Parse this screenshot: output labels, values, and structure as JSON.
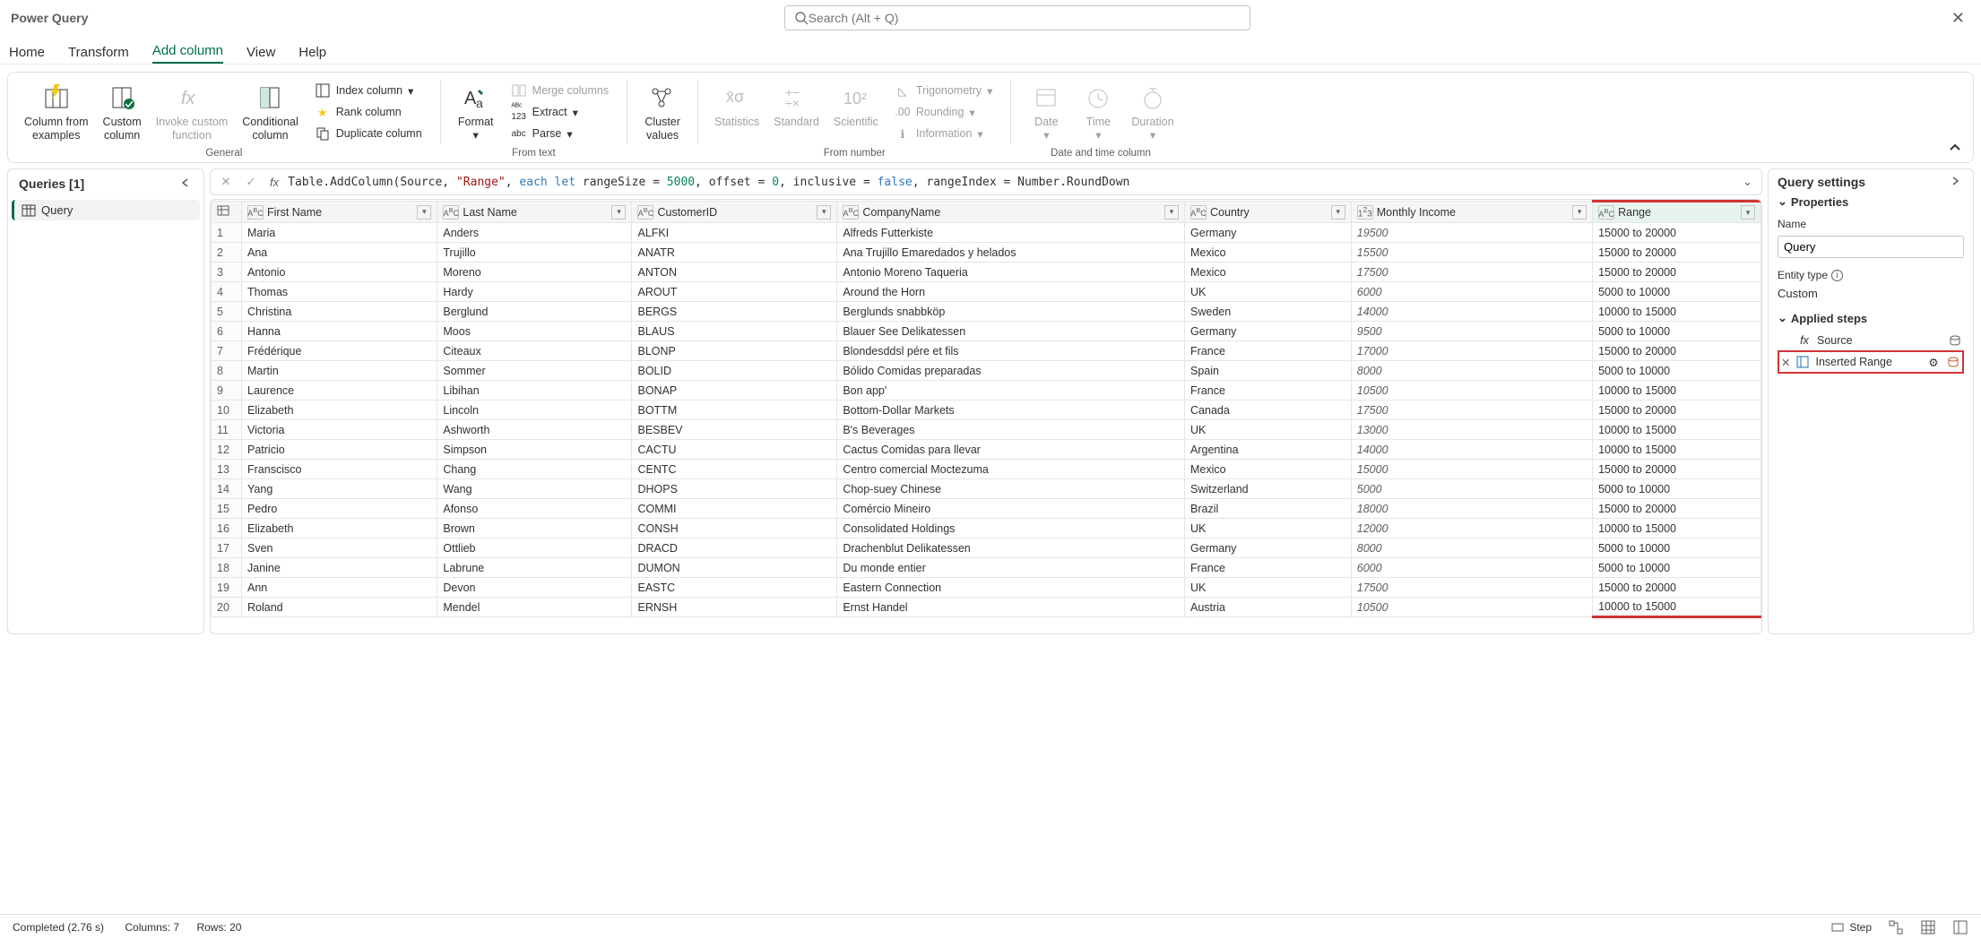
{
  "app_title": "Power Query",
  "search_placeholder": "Search (Alt + Q)",
  "tabs": {
    "home": "Home",
    "transform": "Transform",
    "add_column": "Add column",
    "view": "View",
    "help": "Help"
  },
  "ribbon": {
    "col_from_examples": "Column from\nexamples",
    "custom_column": "Custom\ncolumn",
    "invoke_custom_fn": "Invoke custom\nfunction",
    "conditional_col": "Conditional\ncolumn",
    "index_column": "Index column",
    "rank_column": "Rank column",
    "duplicate_column": "Duplicate column",
    "group_general": "General",
    "format": "Format",
    "merge_columns": "Merge columns",
    "extract": "Extract",
    "parse": "Parse",
    "group_text": "From text",
    "cluster_values": "Cluster\nvalues",
    "statistics": "Statistics",
    "standard": "Standard",
    "scientific": "Scientific",
    "trigonometry": "Trigonometry",
    "rounding": "Rounding",
    "information": "Information",
    "group_number": "From number",
    "date": "Date",
    "time": "Time",
    "duration": "Duration",
    "group_datetime": "Date and time column"
  },
  "queries_pane": {
    "title": "Queries [1]",
    "items": [
      {
        "label": "Query"
      }
    ]
  },
  "formula": {
    "prefix": "Table.AddColumn(Source, ",
    "str_range": "\"Range\"",
    "mid1": ", ",
    "kw_each_let": "each let",
    "mid2": " rangeSize = ",
    "num5000": "5000",
    "mid3": ", offset = ",
    "num0": "0",
    "mid4": ", inclusive = ",
    "bool_false": "false",
    "mid5": ", rangeIndex = Number.RoundDown"
  },
  "columns": [
    {
      "key": "first_name",
      "label": "First Name",
      "type": "text"
    },
    {
      "key": "last_name",
      "label": "Last Name",
      "type": "text"
    },
    {
      "key": "customer_id",
      "label": "CustomerID",
      "type": "text"
    },
    {
      "key": "company_name",
      "label": "CompanyName",
      "type": "text"
    },
    {
      "key": "country",
      "label": "Country",
      "type": "text"
    },
    {
      "key": "monthly_income",
      "label": "Monthly Income",
      "type": "number"
    },
    {
      "key": "range",
      "label": "Range",
      "type": "text"
    }
  ],
  "rows": [
    {
      "n": 1,
      "first_name": "Maria",
      "last_name": "Anders",
      "customer_id": "ALFKI",
      "company_name": "Alfreds Futterkiste",
      "country": "Germany",
      "monthly_income": 19500,
      "range": "15000 to 20000"
    },
    {
      "n": 2,
      "first_name": "Ana",
      "last_name": "Trujillo",
      "customer_id": "ANATR",
      "company_name": "Ana Trujillo Emaredados y helados",
      "country": "Mexico",
      "monthly_income": 15500,
      "range": "15000 to 20000"
    },
    {
      "n": 3,
      "first_name": "Antonio",
      "last_name": "Moreno",
      "customer_id": "ANTON",
      "company_name": "Antonio Moreno Taqueria",
      "country": "Mexico",
      "monthly_income": 17500,
      "range": "15000 to 20000"
    },
    {
      "n": 4,
      "first_name": "Thomas",
      "last_name": "Hardy",
      "customer_id": "AROUT",
      "company_name": "Around the Horn",
      "country": "UK",
      "monthly_income": 6000,
      "range": "5000 to 10000"
    },
    {
      "n": 5,
      "first_name": "Christina",
      "last_name": "Berglund",
      "customer_id": "BERGS",
      "company_name": "Berglunds snabbköp",
      "country": "Sweden",
      "monthly_income": 14000,
      "range": "10000 to 15000"
    },
    {
      "n": 6,
      "first_name": "Hanna",
      "last_name": "Moos",
      "customer_id": "BLAUS",
      "company_name": "Blauer See Delikatessen",
      "country": "Germany",
      "monthly_income": 9500,
      "range": "5000 to 10000"
    },
    {
      "n": 7,
      "first_name": "Frédérique",
      "last_name": "Citeaux",
      "customer_id": "BLONP",
      "company_name": "Blondesddsl pére et fils",
      "country": "France",
      "monthly_income": 17000,
      "range": "15000 to 20000"
    },
    {
      "n": 8,
      "first_name": "Martin",
      "last_name": "Sommer",
      "customer_id": "BOLID",
      "company_name": "Bólido Comidas preparadas",
      "country": "Spain",
      "monthly_income": 8000,
      "range": "5000 to 10000"
    },
    {
      "n": 9,
      "first_name": "Laurence",
      "last_name": "Libihan",
      "customer_id": "BONAP",
      "company_name": "Bon app'",
      "country": "France",
      "monthly_income": 10500,
      "range": "10000 to 15000"
    },
    {
      "n": 10,
      "first_name": "Elizabeth",
      "last_name": "Lincoln",
      "customer_id": "BOTTM",
      "company_name": "Bottom-Dollar Markets",
      "country": "Canada",
      "monthly_income": 17500,
      "range": "15000 to 20000"
    },
    {
      "n": 11,
      "first_name": "Victoria",
      "last_name": "Ashworth",
      "customer_id": "BESBEV",
      "company_name": "B's Beverages",
      "country": "UK",
      "monthly_income": 13000,
      "range": "10000 to 15000"
    },
    {
      "n": 12,
      "first_name": "Patricio",
      "last_name": "Simpson",
      "customer_id": "CACTU",
      "company_name": "Cactus Comidas para llevar",
      "country": "Argentina",
      "monthly_income": 14000,
      "range": "10000 to 15000"
    },
    {
      "n": 13,
      "first_name": "Franscisco",
      "last_name": "Chang",
      "customer_id": "CENTC",
      "company_name": "Centro comercial Moctezuma",
      "country": "Mexico",
      "monthly_income": 15000,
      "range": "15000 to 20000"
    },
    {
      "n": 14,
      "first_name": "Yang",
      "last_name": "Wang",
      "customer_id": "DHOPS",
      "company_name": "Chop-suey Chinese",
      "country": "Switzerland",
      "monthly_income": 5000,
      "range": "5000 to 10000"
    },
    {
      "n": 15,
      "first_name": "Pedro",
      "last_name": "Afonso",
      "customer_id": "COMMI",
      "company_name": "Comércio Mineiro",
      "country": "Brazil",
      "monthly_income": 18000,
      "range": "15000 to 20000"
    },
    {
      "n": 16,
      "first_name": "Elizabeth",
      "last_name": "Brown",
      "customer_id": "CONSH",
      "company_name": "Consolidated Holdings",
      "country": "UK",
      "monthly_income": 12000,
      "range": "10000 to 15000"
    },
    {
      "n": 17,
      "first_name": "Sven",
      "last_name": "Ottlieb",
      "customer_id": "DRACD",
      "company_name": "Drachenblut Delikatessen",
      "country": "Germany",
      "monthly_income": 8000,
      "range": "5000 to 10000"
    },
    {
      "n": 18,
      "first_name": "Janine",
      "last_name": "Labrune",
      "customer_id": "DUMON",
      "company_name": "Du monde entier",
      "country": "France",
      "monthly_income": 6000,
      "range": "5000 to 10000"
    },
    {
      "n": 19,
      "first_name": "Ann",
      "last_name": "Devon",
      "customer_id": "EASTC",
      "company_name": "Eastern Connection",
      "country": "UK",
      "monthly_income": 17500,
      "range": "15000 to 20000"
    },
    {
      "n": 20,
      "first_name": "Roland",
      "last_name": "Mendel",
      "customer_id": "ERNSH",
      "company_name": "Ernst Handel",
      "country": "Austria",
      "monthly_income": 10500,
      "range": "10000 to 15000"
    }
  ],
  "query_settings": {
    "title": "Query settings",
    "properties_label": "Properties",
    "name_label": "Name",
    "name_value": "Query",
    "entity_type_label": "Entity type",
    "entity_type_value": "Custom",
    "applied_steps_label": "Applied steps",
    "steps": [
      {
        "label": "Source"
      },
      {
        "label": "Inserted Range"
      }
    ]
  },
  "status": {
    "completed": "Completed (2.76 s)",
    "columns": "Columns: 7",
    "rows": "Rows: 20",
    "step_label": "Step"
  }
}
